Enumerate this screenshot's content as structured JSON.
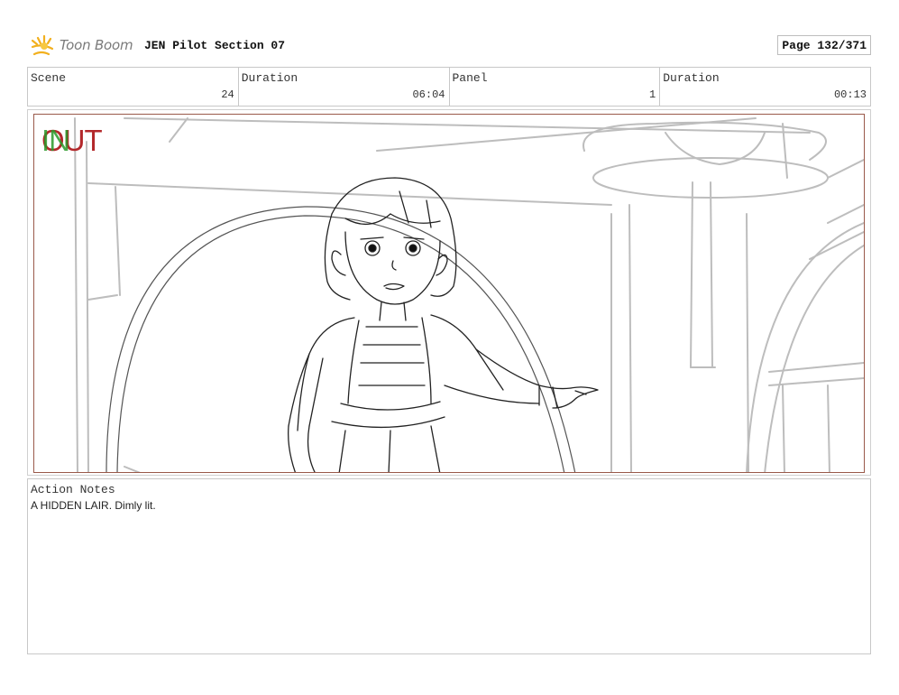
{
  "header": {
    "brand": "Toon Boom",
    "title": "JEN Pilot Section 07",
    "page": "Page 132/371"
  },
  "info": {
    "scene_label": "Scene",
    "scene_value": "24",
    "scene_duration_label": "Duration",
    "scene_duration_value": "06:04",
    "panel_label": "Panel",
    "panel_value": "1",
    "panel_duration_label": "Duration",
    "panel_duration_value": "00:13"
  },
  "panel": {
    "out_marker": "OUT",
    "in_marker": "IN",
    "frame_color": "#9a5a4a"
  },
  "notes": {
    "label": "Action Notes",
    "text": "A HIDDEN LAIR. Dimly lit."
  }
}
